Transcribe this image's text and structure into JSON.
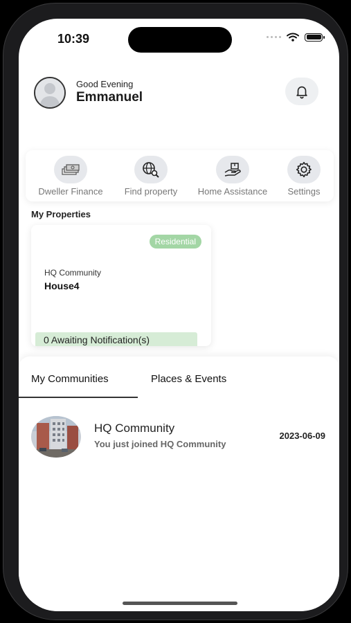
{
  "status_bar": {
    "time": "10:39"
  },
  "header": {
    "greeting": "Good Evening",
    "username": "Emmanuel"
  },
  "quick_actions": [
    {
      "label": "Dweller Finance",
      "icon": "money-stack-icon"
    },
    {
      "label": "Find property",
      "icon": "globe-search-icon"
    },
    {
      "label": "Home Assistance",
      "icon": "hand-box-icon"
    },
    {
      "label": "Settings",
      "icon": "gear-icon"
    }
  ],
  "my_properties": {
    "title": "My Properties",
    "card": {
      "badge": "Residential",
      "community": "HQ Community",
      "house": "House4",
      "notifications": "0 Awaiting Notification(s)"
    }
  },
  "tabs": [
    {
      "label": "My Communities",
      "active": true
    },
    {
      "label": "Places & Events",
      "active": false
    }
  ],
  "communities": [
    {
      "name": "HQ Community",
      "message": "You just joined HQ Community",
      "date": "2023-06-09"
    }
  ],
  "colors": {
    "badge_green": "#a3d6a5",
    "notif_green": "#d6ecd6",
    "icon_bg": "#e6e8ec"
  }
}
